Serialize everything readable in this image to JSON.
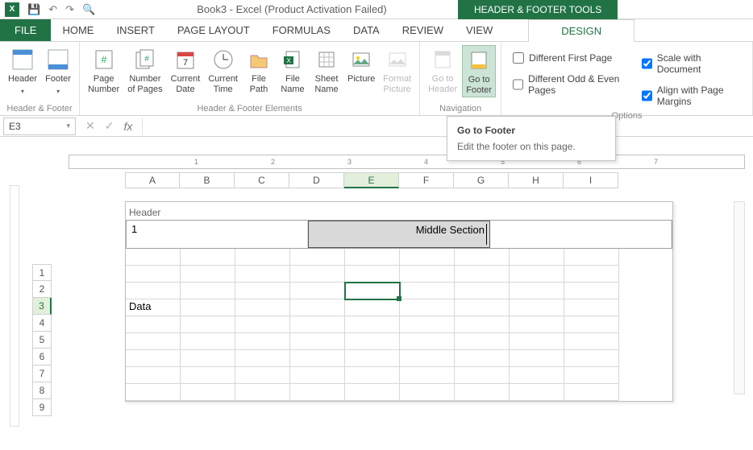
{
  "titlebar": {
    "app_title": "Book3 - Excel (Product Activation Failed)",
    "context_tools": "HEADER & FOOTER TOOLS"
  },
  "tabs": {
    "file": "FILE",
    "home": "HOME",
    "insert": "INSERT",
    "page_layout": "PAGE LAYOUT",
    "formulas": "FORMULAS",
    "data": "DATA",
    "review": "REVIEW",
    "view": "VIEW",
    "design": "DESIGN"
  },
  "ribbon": {
    "hf": {
      "header": "Header",
      "footer": "Footer",
      "label": "Header & Footer"
    },
    "elems": {
      "page_number": "Page\nNumber",
      "number_of_pages": "Number\nof Pages",
      "current_date": "Current\nDate",
      "current_time": "Current\nTime",
      "file_path": "File\nPath",
      "file_name": "File\nName",
      "sheet_name": "Sheet\nName",
      "picture": "Picture",
      "format_picture": "Format\nPicture",
      "label": "Header & Footer Elements"
    },
    "nav": {
      "goto_header": "Go to\nHeader",
      "goto_footer": "Go to\nFooter",
      "label": "Navigation"
    },
    "opts": {
      "diff_first": "Different First Page",
      "diff_odd_even": "Different Odd & Even Pages",
      "scale": "Scale with Document",
      "align": "Align with Page Margins",
      "label": "Options"
    }
  },
  "formula_bar": {
    "namebox": "E3"
  },
  "tooltip": {
    "title": "Go to Footer",
    "body": "Edit the footer on this page."
  },
  "sheet": {
    "columns": [
      "A",
      "B",
      "C",
      "D",
      "E",
      "F",
      "G",
      "H",
      "I"
    ],
    "rows": [
      "1",
      "2",
      "3",
      "4",
      "5",
      "6",
      "7",
      "8",
      "9"
    ],
    "selected_col": "E",
    "selected_row": "3",
    "header_label": "Header",
    "header_left": "1",
    "header_middle": "Middle Section",
    "cells": {
      "A4": "Data"
    },
    "ruler_numbers": [
      "1",
      "2",
      "3",
      "4",
      "5",
      "6",
      "7"
    ]
  }
}
